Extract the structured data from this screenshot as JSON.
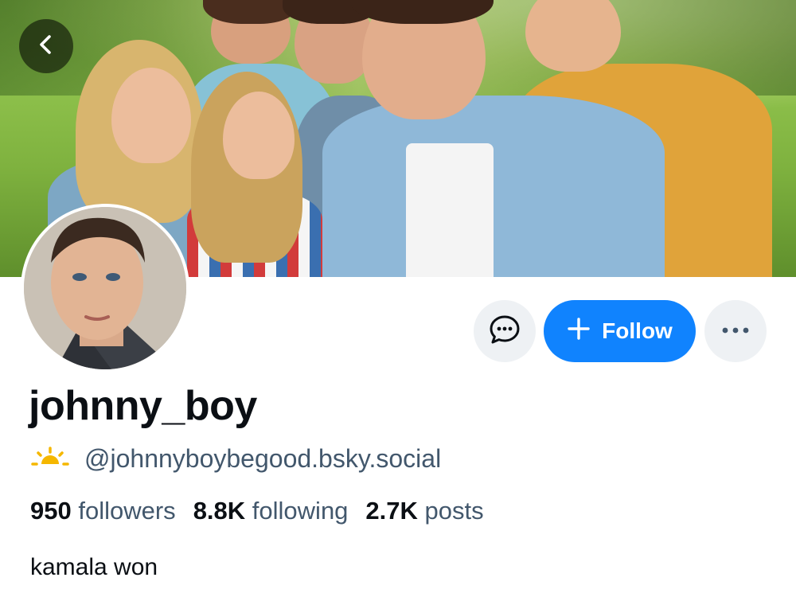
{
  "profile": {
    "display_name": "johnny_boy",
    "handle": "@johnnyboybegood.bsky.social",
    "handle_icon": "sunrise-icon",
    "bio": "kamala won"
  },
  "stats": {
    "followers_count": "950",
    "followers_label": "followers",
    "following_count": "8.8K",
    "following_label": "following",
    "posts_count": "2.7K",
    "posts_label": "posts"
  },
  "actions": {
    "follow_label": "Follow",
    "message_icon": "chat-bubble-icon",
    "more_icon": "ellipsis-icon",
    "back_icon": "chevron-left-icon"
  },
  "colors": {
    "accent": "#1083fe",
    "secondary_text": "#42576c",
    "icon_button_bg": "#eef1f4",
    "sun_icon": "#f5b700"
  }
}
